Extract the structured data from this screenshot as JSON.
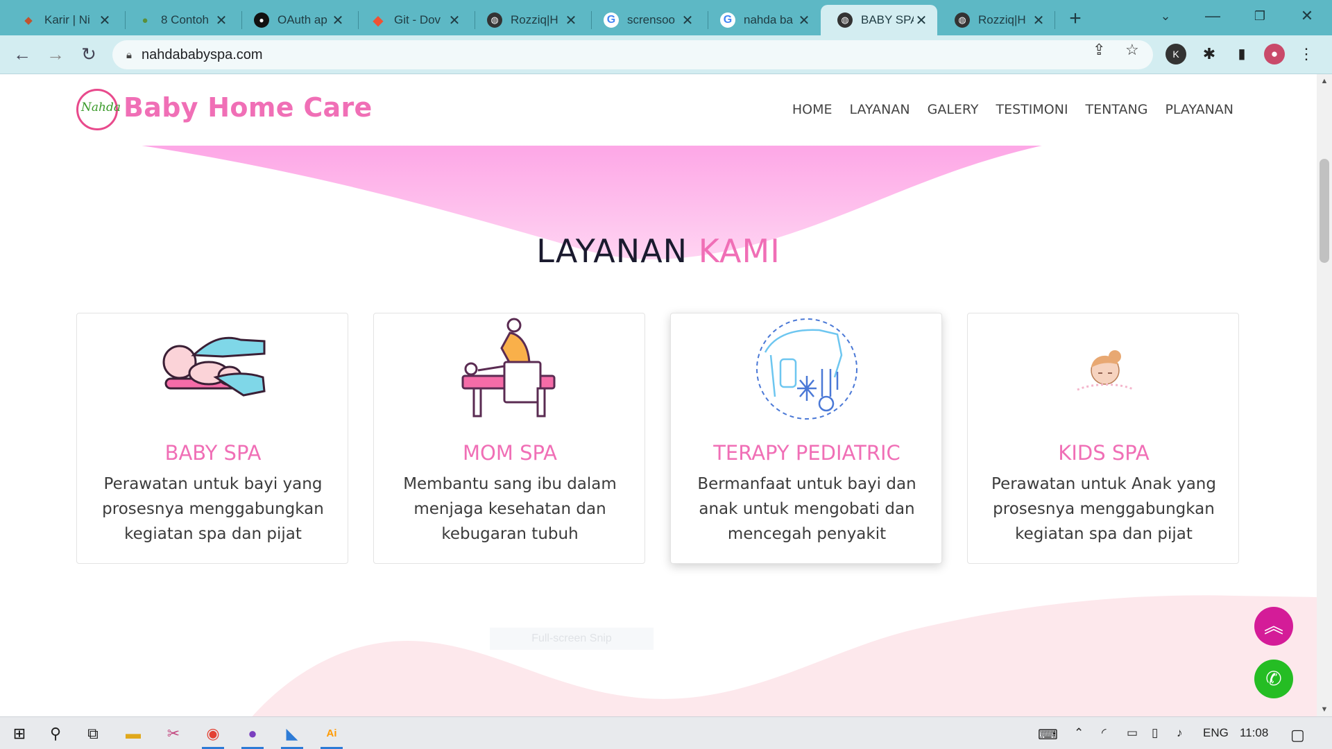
{
  "browser": {
    "tabs": [
      {
        "title": "Karir | Ni",
        "favicon": "wood-icon",
        "color": "#c0532f"
      },
      {
        "title": "8 Contoh",
        "favicon": "owl-icon",
        "color": "#5a8f3a"
      },
      {
        "title": "OAuth ap",
        "favicon": "github-icon",
        "color": "#111111"
      },
      {
        "title": "Git - Dov",
        "favicon": "git-icon",
        "color": "#f05133"
      },
      {
        "title": "Rozziq|H",
        "favicon": "globe-icon",
        "color": "#333333"
      },
      {
        "title": "scrensoo",
        "favicon": "google-icon",
        "color": "#4285f4"
      },
      {
        "title": "nahda ba",
        "favicon": "google-icon",
        "color": "#4285f4"
      },
      {
        "title": "BABY SPA",
        "favicon": "globe-icon",
        "color": "#333333",
        "active": true
      },
      {
        "title": "Rozziq|H",
        "favicon": "globe-icon",
        "color": "#333333"
      }
    ],
    "url": "nahdababyspa.com"
  },
  "site": {
    "logo_mark": "Nahda",
    "logo_text": "Baby Home Care",
    "nav": [
      "HOME",
      "LAYANAN",
      "GALERY",
      "TESTIMONI",
      "TENTANG",
      "PLAYANAN"
    ],
    "section_title_1": "LAYANAN",
    "section_title_2": "KAMI",
    "cards": [
      {
        "title": "BABY SPA",
        "desc": "Perawatan untuk bayi yang prosesnya menggabungkan kegiatan spa dan pijat"
      },
      {
        "title": "MOM SPA",
        "desc": "Membantu sang ibu dalam menjaga kesehatan dan kebugaran tubuh"
      },
      {
        "title": "TERAPY PEDIATRIC",
        "desc": "Bermanfaat untuk bayi dan anak untuk mengobati dan mencegah penyakit"
      },
      {
        "title": "KIDS SPA",
        "desc": "Perawatan untuk Anak yang prosesnya menggabungkan kegiatan spa dan pijat"
      }
    ],
    "snip_overlay": "Full-screen Snip"
  },
  "taskbar": {
    "language": "ENG",
    "time": "11:08"
  },
  "colors": {
    "brand_pink": "#f06fb6",
    "fab_up": "#d41c98",
    "fab_whatsapp": "#25bd24",
    "tabstrip": "#5db8c5"
  }
}
